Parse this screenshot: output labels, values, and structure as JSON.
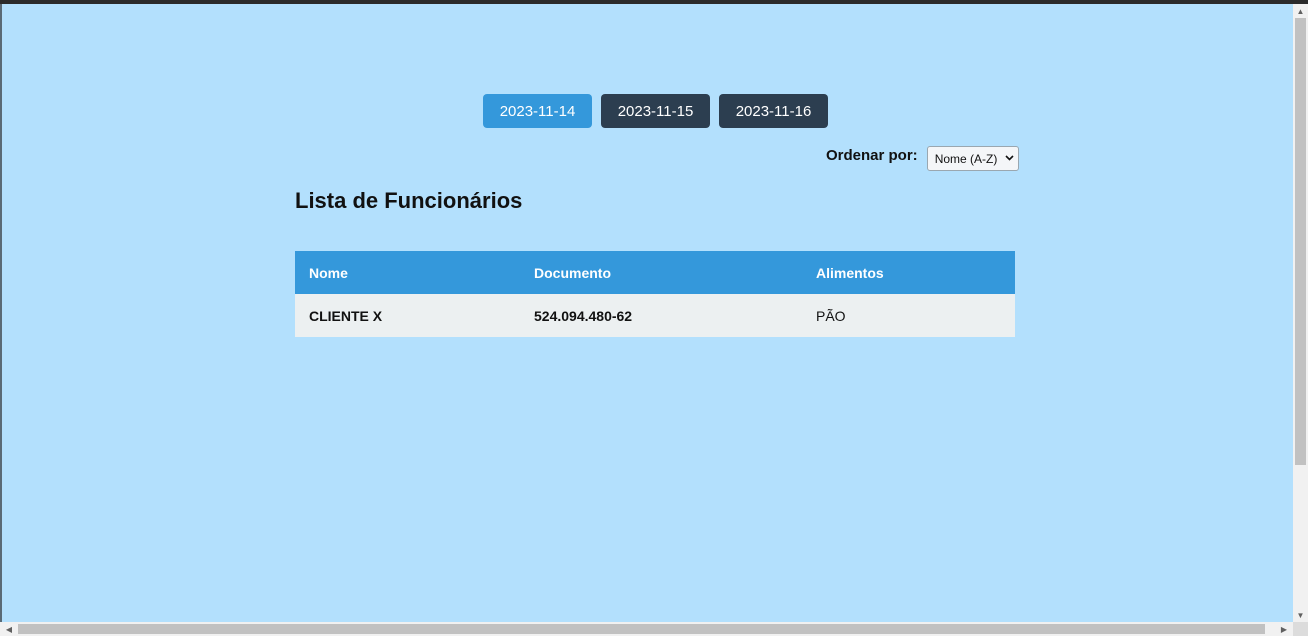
{
  "date_tabs": [
    {
      "label": "2023-11-14",
      "active": true
    },
    {
      "label": "2023-11-15",
      "active": false
    },
    {
      "label": "2023-11-16",
      "active": false
    }
  ],
  "sort": {
    "label": "Ordenar por:",
    "selected": "Nome (A-Z)"
  },
  "page_title": "Lista de Funcionários",
  "table": {
    "headers": [
      "Nome",
      "Documento",
      "Alimentos"
    ],
    "rows": [
      [
        "CLIENTE X",
        "524.094.480-62",
        "PÃO"
      ]
    ]
  },
  "colors": {
    "background": "#b3e0fd",
    "accent": "#3498db",
    "button_dark": "#2c3e50",
    "row_bg": "#ecf0f1"
  },
  "icons": {
    "select": "chevron-down-icon",
    "scroll_up": "scroll-up-arrow-icon",
    "scroll_down": "scroll-down-arrow-icon",
    "scroll_left": "scroll-left-arrow-icon",
    "scroll_right": "scroll-right-arrow-icon"
  }
}
